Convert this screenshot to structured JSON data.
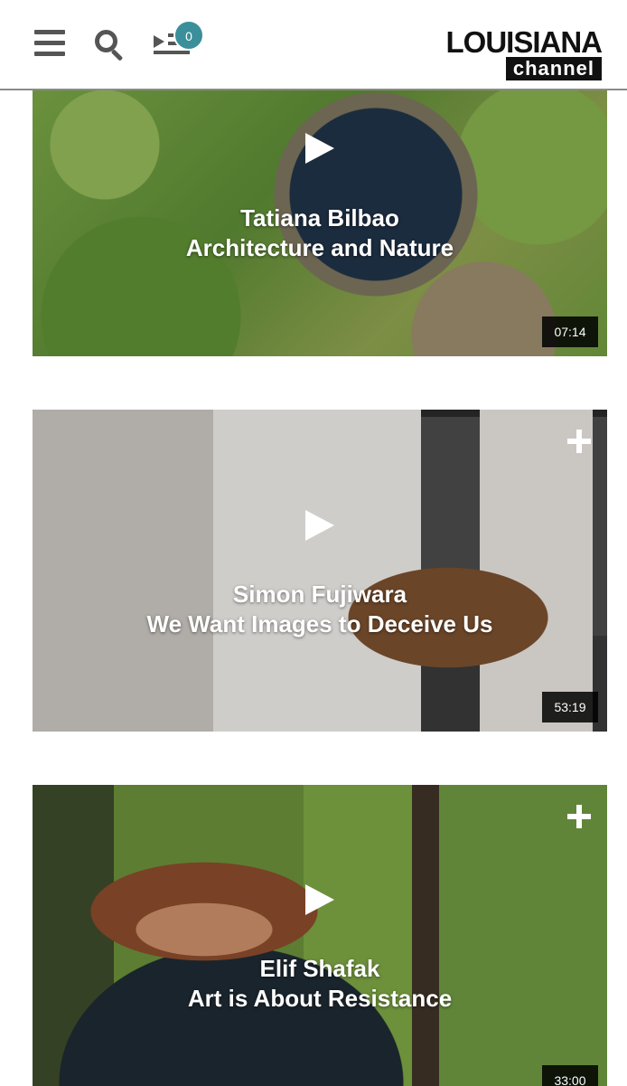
{
  "header": {
    "playlist_count": "0",
    "logo_top": "LOUISIANA",
    "logo_bottom": "channel"
  },
  "videos": [
    {
      "title_line1": "Tatiana Bilbao",
      "title_line2": "Architecture and Nature",
      "duration": "07:14"
    },
    {
      "title_line1": "Simon Fujiwara",
      "title_line2": "We Want Images to Deceive Us",
      "duration": "53:19"
    },
    {
      "title_line1": "Elif Shafak",
      "title_line2": "Art is About Resistance",
      "duration": "33:00"
    }
  ]
}
